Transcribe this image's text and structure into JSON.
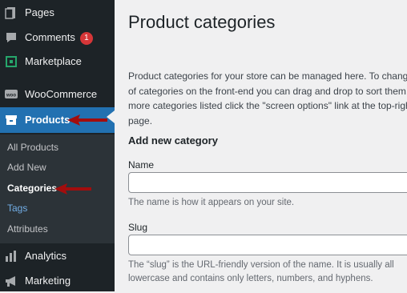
{
  "sidebar": {
    "items": [
      {
        "label": "Pages",
        "icon": "pages-icon"
      },
      {
        "label": "Comments",
        "icon": "comments-icon",
        "badge": "1"
      },
      {
        "label": "Marketplace",
        "icon": "marketplace-icon"
      },
      {
        "label": "WooCommerce",
        "icon": "woocommerce-icon"
      },
      {
        "label": "Products",
        "icon": "products-icon"
      },
      {
        "label": "Analytics",
        "icon": "analytics-icon"
      },
      {
        "label": "Marketing",
        "icon": "marketing-icon"
      }
    ],
    "submenu": [
      "All Products",
      "Add New",
      "Categories",
      "Tags",
      "Attributes"
    ]
  },
  "main": {
    "title": "Product categories",
    "description_lines": [
      "Product categories for your store can be managed here. To change t",
      "of categories on the front-end you can drag and drop to sort them.",
      "more categories listed click the \"screen options\" link at the top-righ",
      "page."
    ],
    "section_title": "Add new category",
    "name_label": "Name",
    "name_help": "The name is how it appears on your site.",
    "slug_label": "Slug",
    "slug_help_lines": [
      "The “slug” is the URL-friendly version of the name. It is usually all",
      "lowercase and contains only letters, numbers, and hyphens."
    ]
  },
  "colors": {
    "sidebar": "#1d2327",
    "current": "#2271b1",
    "submenu": "#2c3338",
    "annotation_arrow": "#a30d0d"
  }
}
